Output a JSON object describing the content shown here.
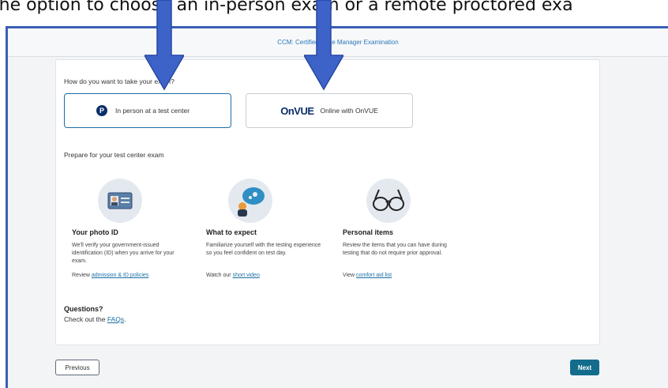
{
  "caption": "the option to choose an in-person exam or a remote proctored exa",
  "header": {
    "title": "CCM: Certified Case Manager Examination"
  },
  "question": "How do you want to take your exam?",
  "options": {
    "in_person": {
      "icon": "pearson-logo-icon",
      "label": "In person at a test center"
    },
    "online": {
      "brand_pre": "On",
      "brand_v": "V",
      "brand_post": "UE",
      "label": "Online with OnVUE"
    }
  },
  "prepare_title": "Prepare for your test center exam",
  "columns": [
    {
      "icon": "photo-id-icon",
      "heading": "Your photo ID",
      "description": "We'll verify your government-issued identification (ID) when you arrive for your exam.",
      "link_prefix": "Review",
      "link_text": "admission & ID policies"
    },
    {
      "icon": "chat-bubble-icon",
      "heading": "What to expect",
      "description": "Familiarize yourself with the testing experience so you feel confident on test day.",
      "link_prefix": "Watch our",
      "link_text": "short video"
    },
    {
      "icon": "glasses-icon",
      "heading": "Personal items",
      "description": "Review the items that you can have during testing that do not require prior approval.",
      "link_prefix": "View",
      "link_text": "comfort aid list"
    }
  ],
  "questions": {
    "heading": "Questions?",
    "prefix": "Check out the",
    "link_text": "FAQs",
    "suffix": "."
  },
  "footer": {
    "previous": "Previous",
    "next": "Next"
  },
  "colors": {
    "arrow": "#3d63c9",
    "accent": "#1d6fa5",
    "next_button": "#136c8c",
    "frame_border": "#3a5fb5"
  }
}
